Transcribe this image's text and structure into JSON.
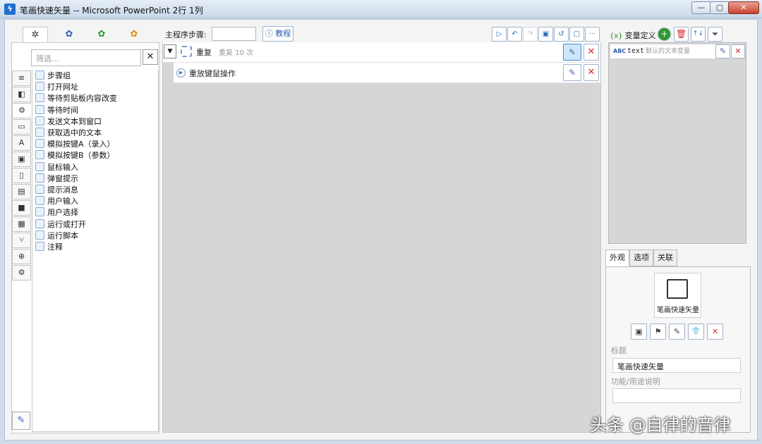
{
  "window": {
    "title": "笔画快速矢量 -- Microsoft PowerPoint 2行 1列",
    "app_icon": "lightning-app-icon",
    "controls": {
      "minimize": "—",
      "maximize": "▢",
      "close": "✕"
    }
  },
  "left_panel": {
    "tabs": [
      {
        "name": "gear-tab",
        "glyph": "✲"
      },
      {
        "name": "blue-tab",
        "glyph": "✿"
      },
      {
        "name": "green-tab",
        "glyph": "✿"
      },
      {
        "name": "orange-tab",
        "glyph": "✿"
      }
    ],
    "filter": {
      "placeholder": "筛选...",
      "clear": "✕"
    },
    "side_icons": [
      "≡",
      "◧",
      "⚙",
      "▭",
      "A",
      "▣",
      "▯",
      "▤",
      "■",
      "▦",
      "⑂",
      "⊕",
      "⚙"
    ],
    "tools": [
      "步骤组",
      "打开网址",
      "等待剪贴板内容改变",
      "等待时间",
      "发送文本到窗口",
      "获取选中的文本",
      "模拟按键A（录入）",
      "模拟按键B（参数）",
      "鼠标输入",
      "弹窗提示",
      "提示消息",
      "用户输入",
      "用户选择",
      "运行或打开",
      "运行脚本",
      "注释"
    ],
    "wrench": "✎"
  },
  "center": {
    "main_steps_label": "主程序步骤:",
    "tutorial_label": "ⓘ 教程",
    "toolbar": [
      "▷",
      "↶",
      "↷",
      "▣",
      "↺",
      "▢",
      "···"
    ],
    "steps": [
      {
        "label": "重复",
        "detail": "重复 10 次",
        "collapse": "▼"
      },
      {
        "label": "重放键鼠操作"
      }
    ],
    "edit_glyph": "✎",
    "delete_glyph": "✕"
  },
  "right_panel": {
    "var_title": "变量定义",
    "var_title_prefix": "{x}",
    "var_buttons": [
      "+",
      "🗑",
      "↑↓",
      "⏷"
    ],
    "variables": [
      {
        "type": "ABC",
        "name": "text",
        "description": "默认的文本变量"
      }
    ],
    "tabs": [
      "外观",
      "选项",
      "关联"
    ],
    "preview_label": "笔画快速矢量",
    "preview_buttons": [
      "▣",
      "⚑",
      "✎",
      "👕",
      "✕"
    ],
    "title_label": "标题",
    "title_value": "笔画快速矢量",
    "desc_label": "功能/用途说明",
    "desc_value": ""
  },
  "watermark": "头条 @自律的音律"
}
